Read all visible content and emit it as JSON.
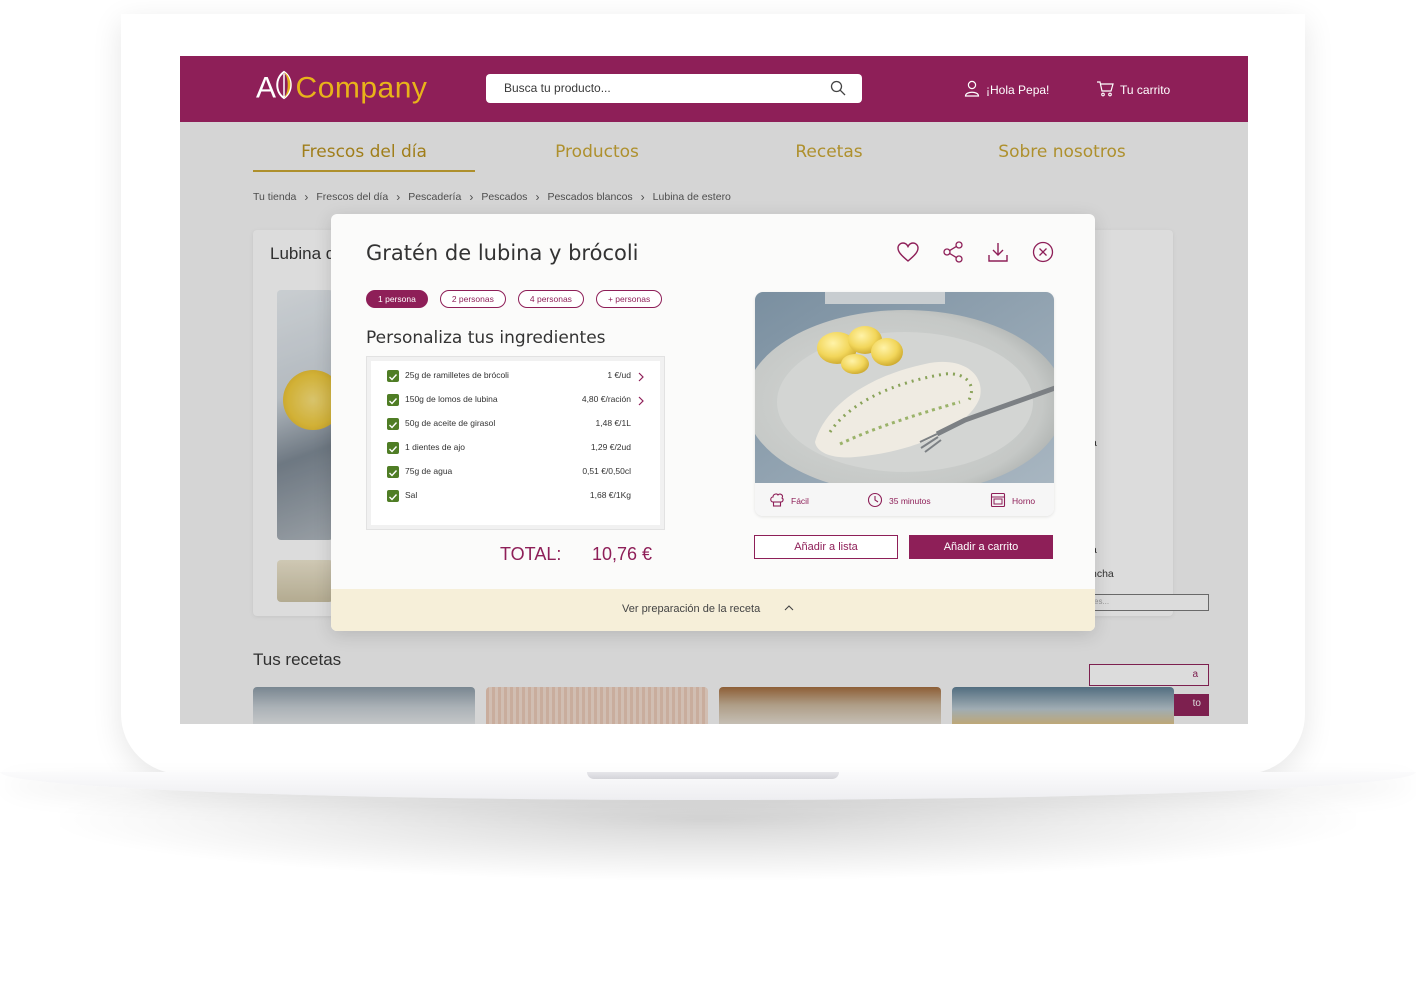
{
  "header": {
    "logo": {
      "a": "A",
      "c": "C",
      "rest": "ompany"
    },
    "search_placeholder": "Busca tu producto...",
    "user_greeting": "¡Hola Pepa!",
    "cart_label": "Tu carrito"
  },
  "nav": {
    "items": [
      "Frescos del día",
      "Productos",
      "Recetas",
      "Sobre nosotros"
    ],
    "active": "Frescos del día"
  },
  "breadcrumb": [
    "Tu tienda",
    "Frescos del día",
    "Pescadería",
    "Pescados",
    "Pescados blancos",
    "Lubina de estero"
  ],
  "product": {
    "title_partial": "Lubina d",
    "side_texts": [
      "a",
      "a",
      "ncha"
    ],
    "input_placeholder": "es...",
    "btn_outline_partial": "a",
    "btn_fill_partial": "to"
  },
  "recipes_section": {
    "title": "Tus recetas"
  },
  "modal": {
    "title": "Gratén de lubina y brócoli",
    "icons": [
      "heart-icon",
      "share-icon",
      "download-icon",
      "close-icon"
    ],
    "portions": [
      "1 persona",
      "2 personas",
      "4 personas",
      "+ personas"
    ],
    "selected_portion": "1 persona",
    "ingredients_title": "Personaliza tus ingredientes",
    "ingredients": [
      {
        "name": "25g de ramilletes de brócoli",
        "price": "1 €/ud",
        "checked": true,
        "expandable": true
      },
      {
        "name": "150g de lomos de lubina",
        "price": "4,80 €/ración",
        "checked": true,
        "expandable": true
      },
      {
        "name": "50g de aceite de girasol",
        "price": "1,48 €/1L",
        "checked": true,
        "expandable": false
      },
      {
        "name": "1 dientes de ajo",
        "price": "1,29 €/2ud",
        "checked": true,
        "expandable": false
      },
      {
        "name": "75g de agua",
        "price": "0,51 €/0,50cl",
        "checked": true,
        "expandable": false
      },
      {
        "name": "Sal",
        "price": "1,68 €/1Kg",
        "checked": true,
        "expandable": false
      }
    ],
    "total_label": "TOTAL:",
    "total_value": "10,76 €",
    "meta": {
      "difficulty": "Fácil",
      "time": "35 minutos",
      "method": "Horno"
    },
    "add_to_list": "Añadir a lista",
    "add_to_cart": "Añadir a carrito",
    "footer_link": "Ver preparación de la receta"
  },
  "colors": {
    "brand": "#8e1f58",
    "gold": "#c9a52f",
    "check": "#4f7d25",
    "footer": "#f6efd9"
  }
}
